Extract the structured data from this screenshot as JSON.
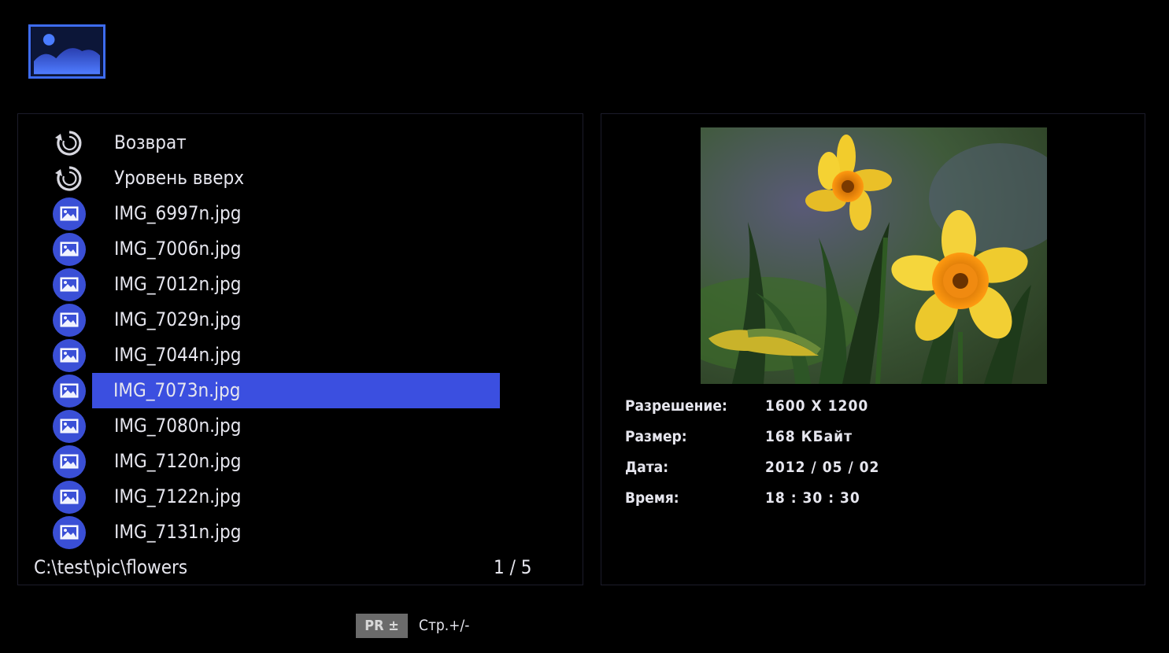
{
  "app_icon": "picture-icon",
  "file_list": {
    "items": [
      {
        "label": "Возврат",
        "icon": "return-icon"
      },
      {
        "label": "Уровень вверх",
        "icon": "return-icon"
      },
      {
        "label": "IMG_6997n.jpg",
        "icon": "image-file-icon"
      },
      {
        "label": "IMG_7006n.jpg",
        "icon": "image-file-icon"
      },
      {
        "label": "IMG_7012n.jpg",
        "icon": "image-file-icon"
      },
      {
        "label": "IMG_7029n.jpg",
        "icon": "image-file-icon"
      },
      {
        "label": "IMG_7044n.jpg",
        "icon": "image-file-icon"
      },
      {
        "label": "IMG_7073n.jpg",
        "icon": "image-file-icon",
        "selected": true
      },
      {
        "label": "IMG_7080n.jpg",
        "icon": "image-file-icon"
      },
      {
        "label": "IMG_7120n.jpg",
        "icon": "image-file-icon"
      },
      {
        "label": "IMG_7122n.jpg",
        "icon": "image-file-icon"
      },
      {
        "label": "IMG_7131n.jpg",
        "icon": "image-file-icon"
      }
    ],
    "path": "C:\\test\\pic\\flowers",
    "page_indicator": "1 / 5"
  },
  "details": {
    "resolution_label": "Разрешение:",
    "resolution_value": "1600 X 1200",
    "size_label": "Размер:",
    "size_value": "168 КБайт",
    "date_label": "Дата:",
    "date_value": "2012 / 05 / 02",
    "time_label": "Время:",
    "time_value": "18 : 30 : 30"
  },
  "footer": {
    "button_label": "PR ±",
    "hint": "Стр.+/-"
  },
  "colors": {
    "accent": "#3b4fe0",
    "background": "#000000",
    "icon_fill": "#3a4fd6"
  }
}
